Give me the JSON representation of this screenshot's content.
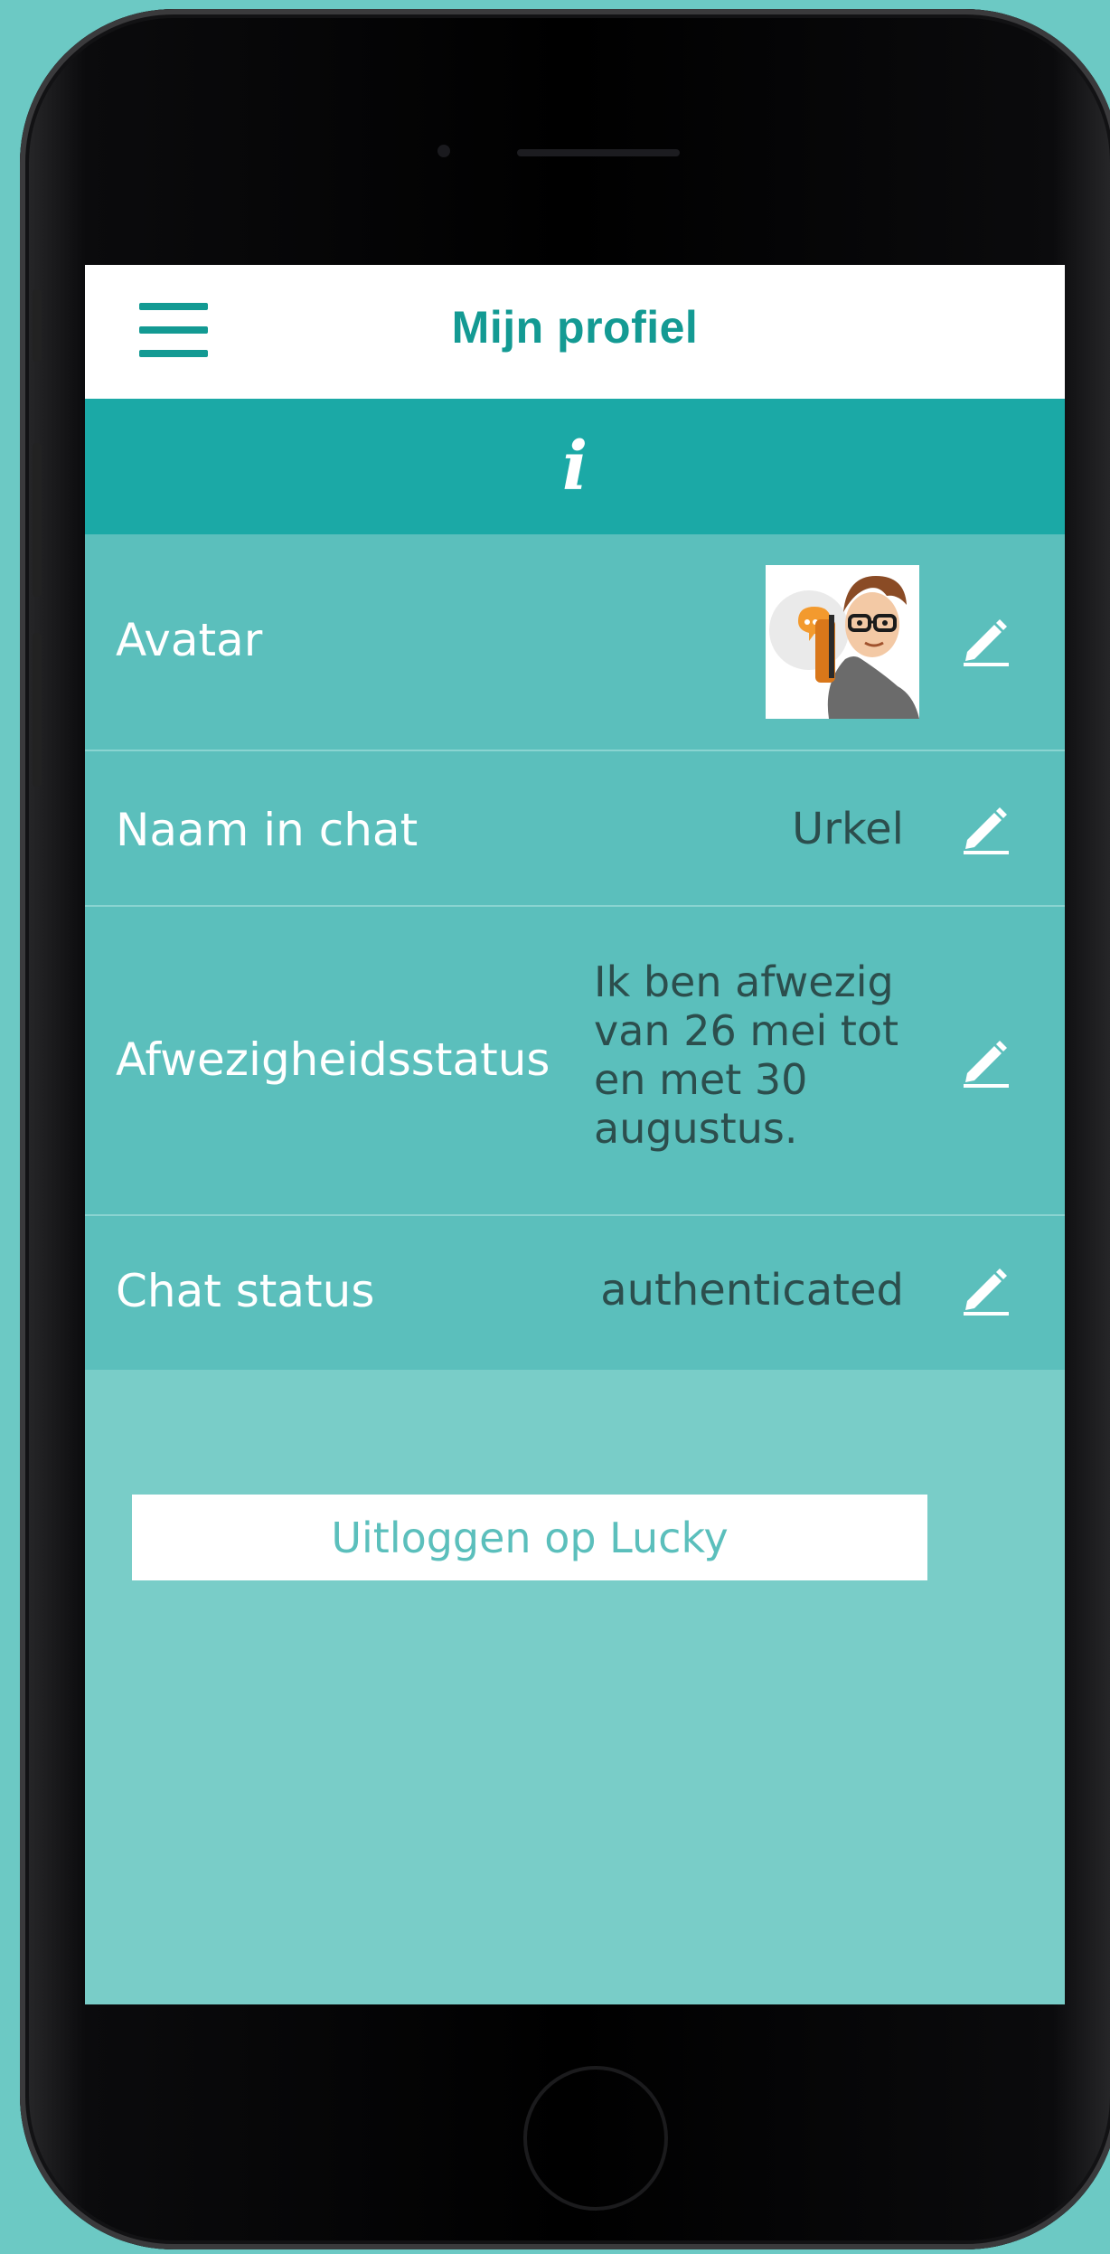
{
  "header": {
    "title": "Mijn profiel"
  },
  "info_bar": {
    "icon_glyph": "i",
    "icon": "info-icon"
  },
  "profile": {
    "rows": [
      {
        "label": "Avatar",
        "value": null,
        "icon": "pencil-icon"
      },
      {
        "label": "Naam in chat",
        "value": "Urkel",
        "icon": "pencil-icon"
      },
      {
        "label": "Afwezigheidsstatus",
        "value": "Ik ben afwezig van 26 mei tot en met 30 augustus.",
        "value_lines": [
          "Ik ben afwezig",
          "van 26 mei tot",
          "en met 30",
          "augustus."
        ],
        "icon": "pencil-icon"
      },
      {
        "label": "Chat status",
        "value": "authenticated",
        "icon": "pencil-icon"
      }
    ]
  },
  "logout": {
    "label": "Uitloggen op Lucky"
  },
  "colors": {
    "background": "#6cc9c4",
    "accent": "#139a93",
    "info_bar": "#1ba9a6",
    "rows": "#5bbfbc",
    "screen": "#79cdc8"
  }
}
